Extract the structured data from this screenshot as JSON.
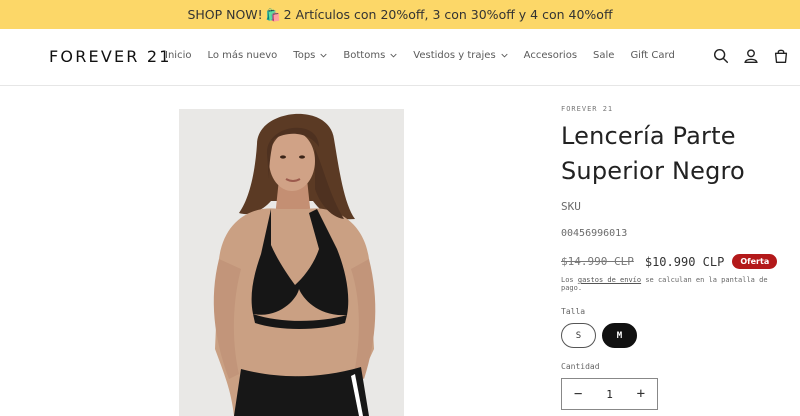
{
  "announcement": {
    "text_before": "SHOP NOW!",
    "bag_emoji": "🛍️",
    "text_after": "2 Artículos con 20%off, 3 con 30%off y 4 con 40%off",
    "background": "#fcd768"
  },
  "header": {
    "logo": "FOREVER 21",
    "nav": [
      {
        "label": "Inicio",
        "dropdown": false
      },
      {
        "label": "Lo más nuevo",
        "dropdown": false
      },
      {
        "label": "Tops",
        "dropdown": true
      },
      {
        "label": "Bottoms",
        "dropdown": true
      },
      {
        "label": "Vestidos y trajes",
        "dropdown": true
      },
      {
        "label": "Accesorios",
        "dropdown": false
      },
      {
        "label": "Sale",
        "dropdown": false
      },
      {
        "label": "Gift Card",
        "dropdown": false
      }
    ],
    "icons": [
      "search-icon",
      "account-icon",
      "cart-icon"
    ]
  },
  "product": {
    "vendor": "FOREVER 21",
    "title": "Lencería Parte Superior Negro",
    "sku_label": "SKU",
    "sku_value": "00456996013",
    "price_old": "$14.990 CLP",
    "price_new": "$10.990 CLP",
    "badge": "Oferta",
    "badge_color": "#b3191a",
    "shipping_before": "Los",
    "shipping_link": "gastos de envío",
    "shipping_after": "se calculan en la pantalla de pago.",
    "size_label": "Talla",
    "sizes": [
      {
        "label": "S",
        "selected": false
      },
      {
        "label": "M",
        "selected": true
      }
    ],
    "quantity_label": "Cantidad",
    "quantity_value": "1",
    "qty_minus": "−",
    "qty_plus": "+"
  }
}
